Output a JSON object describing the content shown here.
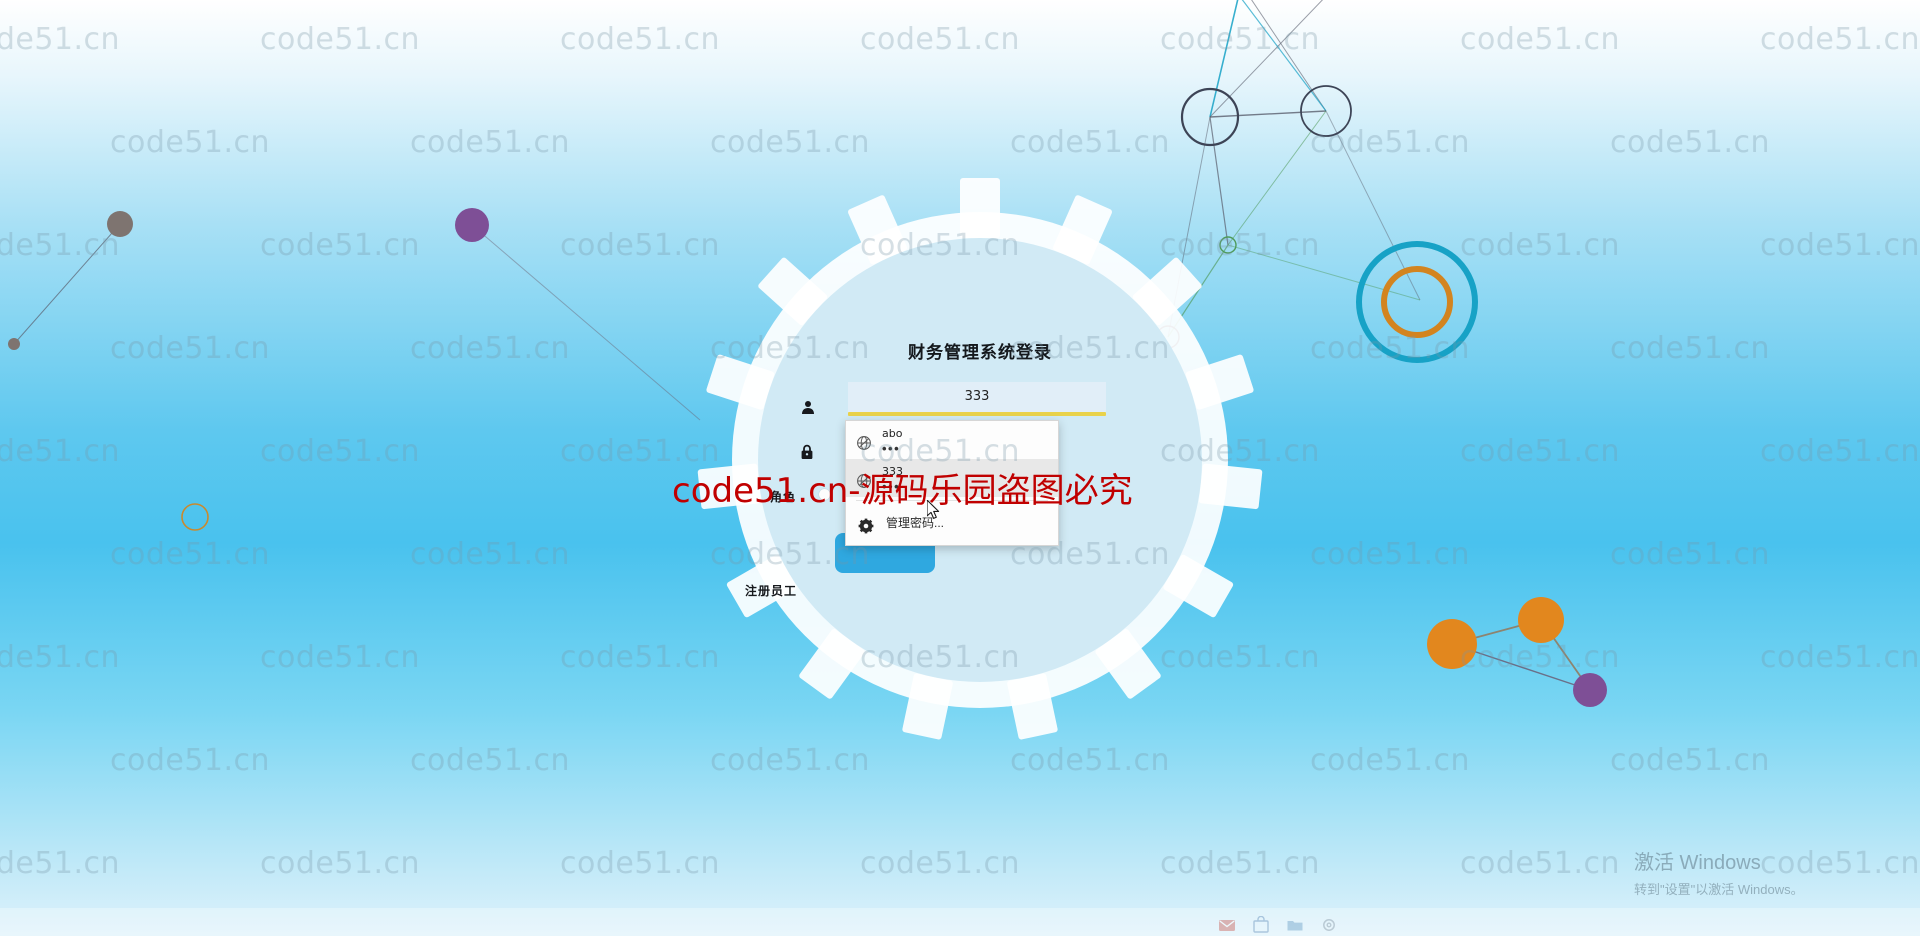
{
  "window": {
    "title": "财务管理系统登录"
  },
  "login_form": {
    "title": "财务管理系统登录",
    "username_icon": "user-icon",
    "username_value": "333",
    "password_icon": "lock-icon",
    "role_label": "角色",
    "login_button_label": "",
    "register_link": "注册员工"
  },
  "autofill_dropdown": {
    "items": [
      {
        "username": "abo",
        "password_mask": "•••",
        "icon": "globe-key-icon",
        "highlighted": false
      },
      {
        "username": "333",
        "password_mask": "•••",
        "icon": "globe-key-icon",
        "highlighted": true
      }
    ],
    "manage_label": "管理密码...",
    "manage_icon": "gear-icon"
  },
  "watermark": {
    "tile_text": "code51.cn",
    "red_text": "code51.cn-源码乐园盗图必究",
    "red_color": "#c00000",
    "tile_color": "#7896a5"
  },
  "windows_activation": {
    "title": "激活 Windows",
    "subtitle": "转到\"设置\"以激活 Windows。"
  },
  "taskbar": {
    "icons": [
      "mail-icon",
      "store-icon",
      "folder-icon",
      "settings-icon"
    ]
  },
  "colors": {
    "accent_blue": "#2fa8e0",
    "field_underline": "#e9d24a",
    "gear_fill": "#ffffff",
    "node_orange": "#e2871e",
    "node_purple": "#7e4f96",
    "node_gray": "#7e7470",
    "ring_cyan": "#17a2c6"
  }
}
